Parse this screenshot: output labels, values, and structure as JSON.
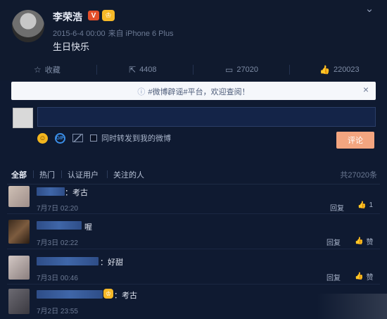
{
  "post": {
    "author": "李荣浩",
    "badge_v": "V",
    "time": "2015-6-4 00:00",
    "source": "来自 iPhone 6 Plus",
    "text": "生日快乐"
  },
  "actions": {
    "favorite": "收藏",
    "share_count": "4408",
    "comment_count": "27020",
    "like_count": "220023"
  },
  "notice": {
    "text": "#微博辟谣#平台，欢迎查阅！"
  },
  "composer": {
    "repost_label": "同时转发到我的微博",
    "submit": "评论"
  },
  "filters": {
    "all": "全部",
    "hot": "热门",
    "verified": "认证用户",
    "following": "关注的人",
    "total": "共27020条"
  },
  "comments": [
    {
      "text": "：考古",
      "time": "7月7日 02:20",
      "reply": "回复",
      "like": "1"
    },
    {
      "text": "喔",
      "time": "7月3日 02:22",
      "reply": "回复",
      "like": "赞"
    },
    {
      "text": "：好甜",
      "time": "7月3日 00:46",
      "reply": "回复",
      "like": "赞"
    },
    {
      "text": "：考古",
      "time": "7月2日 23:55",
      "reply": "",
      "like": ""
    }
  ],
  "colors": {
    "background": "#101a2e",
    "accent": "#f3a580",
    "link": "#3a8de6"
  }
}
